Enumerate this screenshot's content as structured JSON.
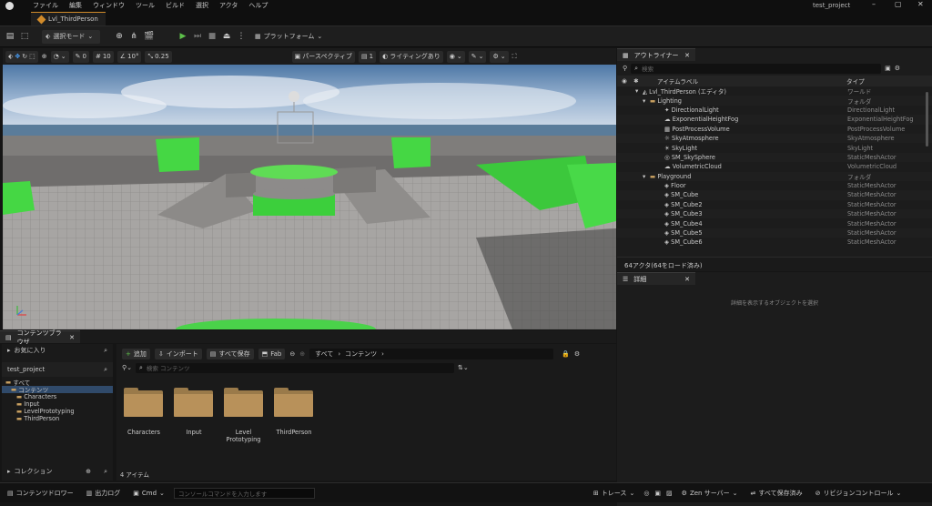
{
  "titlebar": {
    "menus": [
      "ファイル",
      "編集",
      "ウィンドウ",
      "ツール",
      "ビルド",
      "選択",
      "アクタ",
      "ヘルプ"
    ],
    "project": "test_project"
  },
  "tabs": {
    "level": "Lvl_ThirdPerson"
  },
  "toolbar": {
    "mode": "選択モード",
    "platforms": "プラットフォーム"
  },
  "viewport": {
    "snap_move": "10",
    "snap_rot": "10°",
    "snap_scale": "0.25",
    "cam_speed": "0",
    "perspective": "パースペクティブ",
    "lit": "ライティングあり",
    "view_count": "1"
  },
  "outliner": {
    "tab": "アウトライナー",
    "search_placeholder": "検索",
    "col_label": "アイテムラベル",
    "col_type": "タイプ",
    "rows": [
      {
        "name": "Lvl_ThirdPerson (エディタ)",
        "type": "ワールド"
      },
      {
        "name": "Lighting",
        "type": "フォルダ"
      },
      {
        "name": "DirectionalLight",
        "type": "DirectionalLight"
      },
      {
        "name": "ExponentialHeightFog",
        "type": "ExponentialHeightFog"
      },
      {
        "name": "PostProcessVolume",
        "type": "PostProcessVolume"
      },
      {
        "name": "SkyAtmosphere",
        "type": "SkyAtmosphere"
      },
      {
        "name": "SkyLight",
        "type": "SkyLight"
      },
      {
        "name": "SM_SkySphere",
        "type": "StaticMeshActor"
      },
      {
        "name": "VolumetricCloud",
        "type": "VolumetricCloud"
      },
      {
        "name": "Playground",
        "type": "フォルダ"
      },
      {
        "name": "Floor",
        "type": "StaticMeshActor"
      },
      {
        "name": "SM_Cube",
        "type": "StaticMeshActor"
      },
      {
        "name": "SM_Cube2",
        "type": "StaticMeshActor"
      },
      {
        "name": "SM_Cube3",
        "type": "StaticMeshActor"
      },
      {
        "name": "SM_Cube4",
        "type": "StaticMeshActor"
      },
      {
        "name": "SM_Cube5",
        "type": "StaticMeshActor"
      },
      {
        "name": "SM_Cube6",
        "type": "StaticMeshActor"
      }
    ],
    "footer": "64アクタ(64をロード済み)"
  },
  "details": {
    "tab": "詳細",
    "empty": "詳細を表示するオブジェクトを選択"
  },
  "content": {
    "tab": "コンテンツブラウザ",
    "favorites": "お気に入り",
    "project": "test_project",
    "tree": [
      "すべて",
      "コンテンツ",
      "Characters",
      "Input",
      "LevelPrototyping",
      "ThirdPerson"
    ],
    "collections": "コレクション",
    "add": "追加",
    "import": "インポート",
    "saveall": "すべて保存",
    "fab": "Fab",
    "path": [
      "すべて",
      "コンテンツ"
    ],
    "search_placeholder": "検索 コンテンツ",
    "folders": [
      "Characters",
      "Input",
      "Level Prototyping",
      "ThirdPerson"
    ],
    "count": "4 アイテム"
  },
  "status": {
    "drawer": "コンテンツドロワー",
    "log": "出力ログ",
    "cmd": "Cmd",
    "cmd_placeholder": "コンソールコマンドを入力します",
    "trace": "トレース",
    "zen": "Zen サーバー",
    "saved": "すべて保存済み",
    "revision": "リビジョンコントロール"
  }
}
